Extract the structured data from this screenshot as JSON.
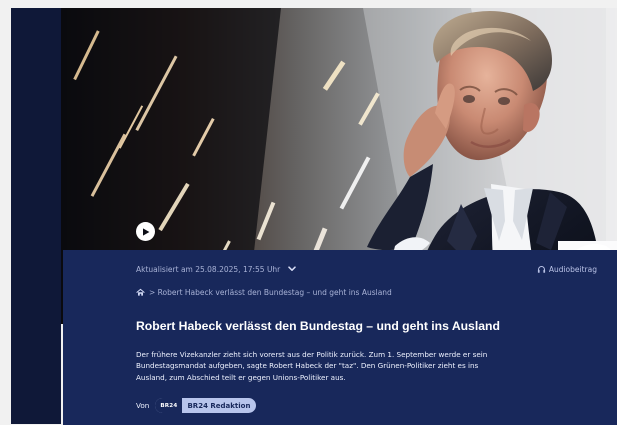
{
  "hero": {
    "play_icon": "play-icon"
  },
  "article": {
    "updated": "Aktualisiert am 25.08.2025, 17:55 Uhr",
    "audio_label": "Audiobeitrag",
    "breadcrumb": "> Robert Habeck verlässt den Bundestag – und geht ins Ausland",
    "title": "Robert Habeck verlässt den Bundestag – und geht ins Ausland",
    "teaser": "Der frühere Vizekanzler zieht sich vorerst aus der Politik zurück. Zum 1. September werde er sein Bundestagsmandat aufgeben, sagte Robert Habeck der \"taz\". Den Grünen-Politiker zieht es ins Ausland, zum Abschied teilt er gegen Unions-Politiker aus.",
    "by_label": "Von",
    "author_logo": "BR24",
    "author_name": "BR24 Redaktion"
  },
  "icons": {
    "home": "home-icon",
    "audio": "headphones-icon",
    "dropdown": "chevron-down-icon"
  },
  "colors": {
    "panel": "#18285b",
    "page": "#f1f1f1",
    "chip": "#b8c5ec"
  }
}
